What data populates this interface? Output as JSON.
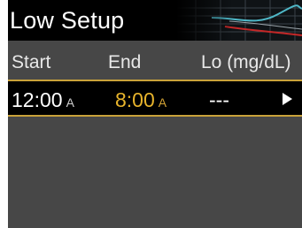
{
  "title": "Low Setup",
  "columns": {
    "start": "Start",
    "end": "End",
    "lo": "Lo (mg/dL)"
  },
  "row": {
    "start_time": "12:00",
    "start_ampm": "A",
    "end_time": "8:00",
    "end_ampm": "A",
    "lo_value": "---"
  },
  "icons": {
    "row_action": "play-arrow-icon",
    "header_graphic": "glucose-graph-icon"
  },
  "colors": {
    "screen_bg": "#474747",
    "bar_bg": "#000000",
    "highlight": "#c9a23a",
    "end_text": "#e8b42c"
  }
}
